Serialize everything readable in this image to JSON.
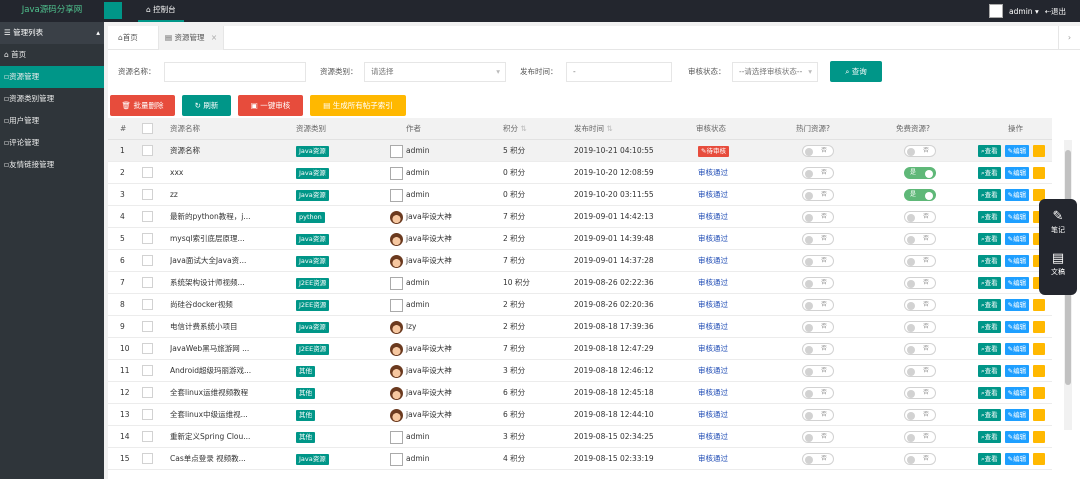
{
  "topbar": {
    "logo": "Java源码分享网",
    "tab": "控制台",
    "user": "admin",
    "logout": "退出",
    "icons": {
      "dashboard": "dashboard-icon",
      "logout": "logout-icon"
    }
  },
  "sidebar": {
    "header": "管理列表",
    "items": [
      {
        "label": "首页"
      },
      {
        "label": "资源管理",
        "active": true
      },
      {
        "label": "资源类别管理"
      },
      {
        "label": "用户管理"
      },
      {
        "label": "评论管理"
      },
      {
        "label": "友情链接管理"
      }
    ]
  },
  "tabs": [
    {
      "label": "首页"
    },
    {
      "label": "资源管理",
      "close": "×"
    }
  ],
  "filter": {
    "name_label": "资源名称：",
    "type_label": "资源类别：",
    "type_value": "请选择",
    "date_label": "发布时间：",
    "date_value": "-",
    "state_label": "审核状态：",
    "state_value": "--请选择审核状态--",
    "search": "查询"
  },
  "toolbar": {
    "batch_delete": "批量删除",
    "refresh": "刷新",
    "approve_all": "一键审核",
    "gen_index": "生成所有帖子索引"
  },
  "table": {
    "headers": [
      "#",
      "资源名称",
      "资源类别",
      "作者",
      "积分",
      "发布时间",
      "审核状态",
      "热门资源?",
      "免费资源?",
      "操作"
    ],
    "ops": {
      "view": "查看",
      "edit": "编辑"
    },
    "switch_off": "否",
    "switch_on": "是",
    "rows": [
      {
        "n": "1",
        "name": "资源名称",
        "cat": "Java资源",
        "author": "admin",
        "avatar": "broken",
        "pts": "5 积分",
        "time": "2019-10-21 04:10:55",
        "state": "待审核",
        "hot": false,
        "free": false
      },
      {
        "n": "2",
        "name": "xxx",
        "cat": "Java资源",
        "author": "admin",
        "avatar": "broken",
        "pts": "0 积分",
        "time": "2019-10-20 12:08:59",
        "state": "审核通过",
        "hot": false,
        "free": true
      },
      {
        "n": "3",
        "name": "zz",
        "cat": "Java资源",
        "author": "admin",
        "avatar": "broken",
        "pts": "0 积分",
        "time": "2019-10-20 03:11:55",
        "state": "审核通过",
        "hot": false,
        "free": true
      },
      {
        "n": "4",
        "name": "最新的python教程，j...",
        "cat": "python",
        "author": "java毕设大神",
        "avatar": "face",
        "pts": "7 积分",
        "time": "2019-09-01 14:42:13",
        "state": "审核通过",
        "hot": false,
        "free": false
      },
      {
        "n": "5",
        "name": "mysql索引底层原理...",
        "cat": "Java资源",
        "author": "java毕设大神",
        "avatar": "face",
        "pts": "2 积分",
        "time": "2019-09-01 14:39:48",
        "state": "审核通过",
        "hot": false,
        "free": false
      },
      {
        "n": "6",
        "name": "Java面试大全Java资...",
        "cat": "Java资源",
        "author": "java毕设大神",
        "avatar": "face",
        "pts": "7 积分",
        "time": "2019-09-01 14:37:28",
        "state": "审核通过",
        "hot": false,
        "free": false
      },
      {
        "n": "7",
        "name": "系统架构设计师视频...",
        "cat": "J2EE资源",
        "author": "admin",
        "avatar": "broken",
        "pts": "10 积分",
        "time": "2019-08-26 02:22:36",
        "state": "审核通过",
        "hot": false,
        "free": false
      },
      {
        "n": "8",
        "name": "尚硅谷docker视频",
        "cat": "J2EE资源",
        "author": "admin",
        "avatar": "broken",
        "pts": "2 积分",
        "time": "2019-08-26 02:20:36",
        "state": "审核通过",
        "hot": false,
        "free": false
      },
      {
        "n": "9",
        "name": "电信计费系统小项目",
        "cat": "Java资源",
        "author": "lzy",
        "avatar": "face",
        "pts": "2 积分",
        "time": "2019-08-18 17:39:36",
        "state": "审核通过",
        "hot": false,
        "free": false
      },
      {
        "n": "10",
        "name": "JavaWeb黑马旅游网 ...",
        "cat": "J2EE资源",
        "author": "java毕设大神",
        "avatar": "face",
        "pts": "7 积分",
        "time": "2019-08-18 12:47:29",
        "state": "审核通过",
        "hot": false,
        "free": false
      },
      {
        "n": "11",
        "name": "Android超级玛丽游戏...",
        "cat": "其他",
        "author": "java毕设大神",
        "avatar": "face",
        "pts": "3 积分",
        "time": "2019-08-18 12:46:12",
        "state": "审核通过",
        "hot": false,
        "free": false
      },
      {
        "n": "12",
        "name": "全套linux运维视频教程",
        "cat": "其他",
        "author": "java毕设大神",
        "avatar": "face",
        "pts": "6 积分",
        "time": "2019-08-18 12:45:18",
        "state": "审核通过",
        "hot": false,
        "free": false
      },
      {
        "n": "13",
        "name": "全套linux中级运维视...",
        "cat": "其他",
        "author": "java毕设大神",
        "avatar": "face",
        "pts": "6 积分",
        "time": "2019-08-18 12:44:10",
        "state": "审核通过",
        "hot": false,
        "free": false
      },
      {
        "n": "14",
        "name": "重新定义Spring Clou...",
        "cat": "其他",
        "author": "admin",
        "avatar": "broken",
        "pts": "3 积分",
        "time": "2019-08-15 02:34:25",
        "state": "审核通过",
        "hot": false,
        "free": false
      },
      {
        "n": "15",
        "name": "Cas单点登录 视频教...",
        "cat": "Java资源",
        "author": "admin",
        "avatar": "broken",
        "pts": "4 积分",
        "time": "2019-08-15 02:33:19",
        "state": "审核通过",
        "hot": false,
        "free": false
      }
    ]
  },
  "float_panel": {
    "notes": "笔记",
    "doc": "文稿"
  },
  "colors": {
    "accent": "#009688",
    "danger": "#e74c3c",
    "info": "#1e9fff",
    "warn": "#ffb800",
    "dark": "#23262e"
  }
}
